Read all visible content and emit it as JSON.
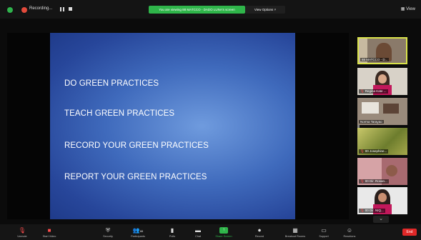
{
  "top_bar": {
    "recording_label": "Recording...",
    "sharing_banner": "You are viewing 88 MATCCO - DADO LUNA's screen",
    "view_options_label": "View Options ˅",
    "view_label": "View"
  },
  "slide": {
    "lines": [
      "DO GREEN PRACTICES",
      "TEACH GREEN PRACTICES",
      "RECORD YOUR GREEN PRACTICES",
      "REPORT YOUR GREEN PRACTICES"
    ]
  },
  "participants": [
    {
      "name": "88 MATCCO - D...",
      "muted": false,
      "active": true
    },
    {
      "name": "Regina Kate ...",
      "muted": true,
      "active": false
    },
    {
      "name": "Norma Tarayao",
      "muted": false,
      "active": false
    },
    {
      "name": "00 Josephine...",
      "muted": true,
      "active": false
    },
    {
      "name": "00 Dir. Rosan...",
      "muted": true,
      "active": false
    },
    {
      "name": "00 Dir. NIQ...",
      "muted": true,
      "active": false
    }
  ],
  "toolbar": {
    "unmute": "Unmute",
    "start_video": "Start Video",
    "security": "Security",
    "participants": "Participants",
    "participants_count": "88",
    "polls": "Polls",
    "chat": "Chat",
    "share_screen": "Share Screen",
    "record": "Record",
    "breakout_rooms": "Breakout Rooms",
    "support": "Support",
    "reactions": "Reactions",
    "end": "End"
  },
  "colors": {
    "share_green": "#2fb54a",
    "end_red": "#e02828",
    "active_speaker": "#d9e34a",
    "slide_blue": "#3f6abc"
  }
}
